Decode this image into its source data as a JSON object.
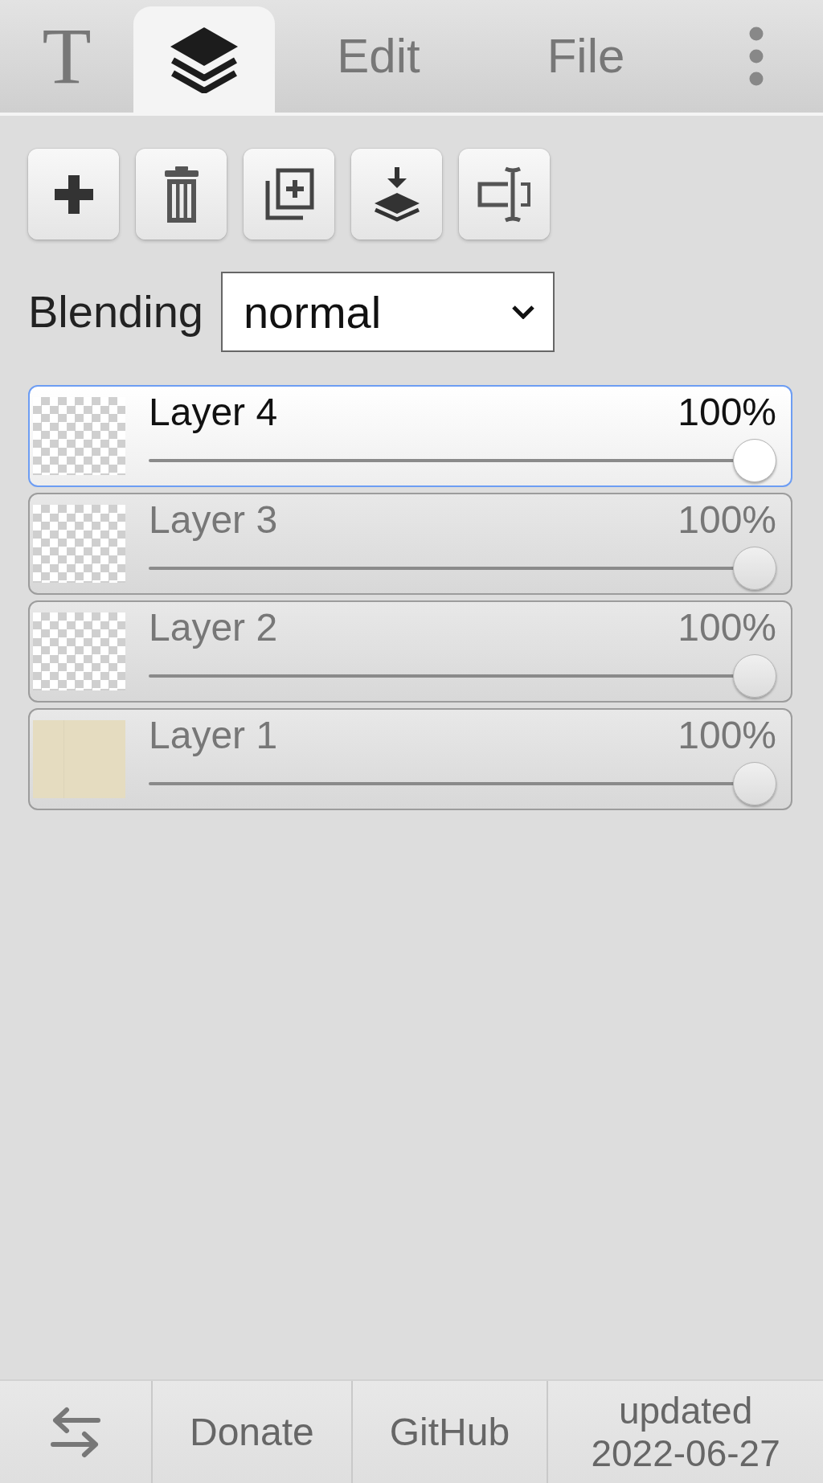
{
  "tabs": [
    {
      "kind": "glyph",
      "label": "T",
      "selected": false
    },
    {
      "kind": "layers",
      "selected": true
    },
    {
      "kind": "text",
      "label": "Edit",
      "selected": false
    },
    {
      "kind": "text",
      "label": "File",
      "selected": false
    }
  ],
  "toolbar": [
    {
      "kind": "add"
    },
    {
      "kind": "delete"
    },
    {
      "kind": "duplicate"
    },
    {
      "kind": "merge-down"
    },
    {
      "kind": "rename"
    }
  ],
  "blending": {
    "label": "Blending",
    "value": "normal"
  },
  "layers": [
    {
      "name": "Layer 4",
      "opacity": "100%",
      "level": 1,
      "selected": true,
      "thumbnail": {
        "kind": "transparent"
      }
    },
    {
      "name": "Layer 3",
      "opacity": "100%",
      "level": 1,
      "selected": false,
      "thumbnail": {
        "kind": "transparent"
      }
    },
    {
      "name": "Layer 2",
      "opacity": "100%",
      "level": 1,
      "selected": false,
      "thumbnail": {
        "kind": "transparent"
      }
    },
    {
      "name": "Layer 1",
      "opacity": "100%",
      "level": 1,
      "selected": false,
      "thumbnail": {
        "kind": "solid",
        "color": "#e5dcc0"
      }
    }
  ],
  "footer": [
    {
      "kind": "icon"
    },
    {
      "kind": "link",
      "label": "Donate"
    },
    {
      "kind": "link",
      "label": "GitHub"
    },
    {
      "kind": "text",
      "label": "updated 2022-06-27"
    }
  ]
}
